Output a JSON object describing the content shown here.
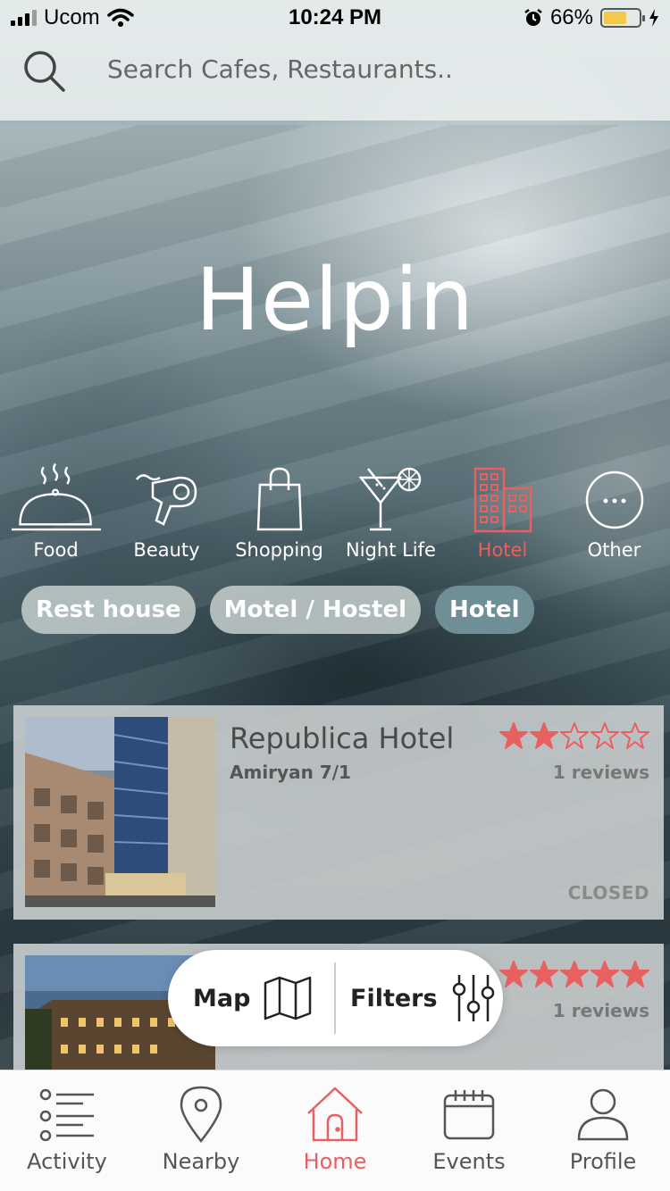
{
  "status_bar": {
    "carrier": "Ucom",
    "time": "10:24 PM",
    "battery": "66%",
    "battery_level": 0.66
  },
  "search": {
    "placeholder": "Search Cafes, Restaurants.."
  },
  "app_title": "Helpin",
  "categories": [
    {
      "label": "Food",
      "icon": "food-cloche-icon",
      "active": false
    },
    {
      "label": "Beauty",
      "icon": "hair-dryer-icon",
      "active": false
    },
    {
      "label": "Shopping",
      "icon": "shopping-bag-icon",
      "active": false
    },
    {
      "label": "Night Life",
      "icon": "cocktail-icon",
      "active": true
    },
    {
      "label": "Hotel",
      "icon": "hotel-building-icon",
      "active": true
    },
    {
      "label": "Other",
      "icon": "more-icon",
      "active": false
    }
  ],
  "subcategories": [
    {
      "label": "Rest house",
      "active": false
    },
    {
      "label": "Motel / Hostel",
      "active": false
    },
    {
      "label": "Hotel",
      "active": true
    }
  ],
  "listings": [
    {
      "title": "Republica Hotel",
      "address": "Amiryan 7/1",
      "rating": 2,
      "max_rating": 5,
      "reviews": "1 reviews",
      "status": "CLOSED"
    },
    {
      "rating": 5,
      "max_rating": 5,
      "reviews": "1 reviews"
    }
  ],
  "float_actions": {
    "map_label": "Map",
    "filters_label": "Filters"
  },
  "tabs": [
    {
      "label": "Activity",
      "icon": "list-icon"
    },
    {
      "label": "Nearby",
      "icon": "location-pin-icon"
    },
    {
      "label": "Home",
      "icon": "home-icon",
      "active": true
    },
    {
      "label": "Events",
      "icon": "calendar-icon"
    },
    {
      "label": "Profile",
      "icon": "user-icon"
    }
  ],
  "colors": {
    "accent": "#e86060",
    "chip": "#bec8c6",
    "chip_active": "#6f8f96",
    "battery": "#f2c94c"
  }
}
